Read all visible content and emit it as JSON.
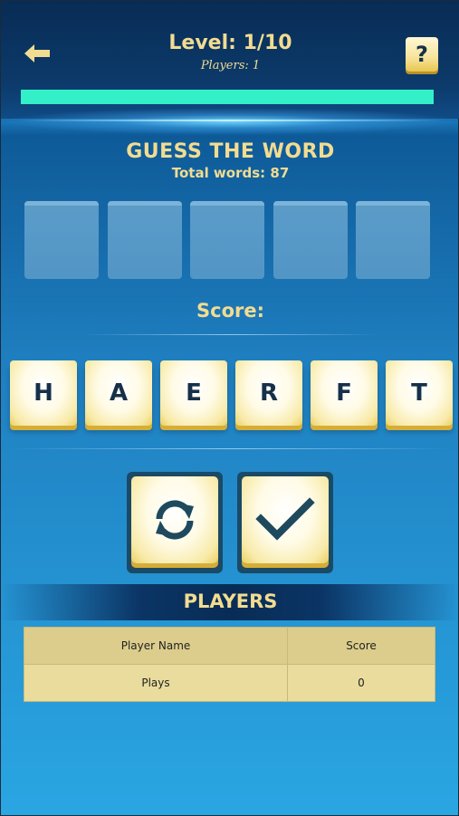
{
  "header": {
    "back_icon": "arrow-left-icon",
    "level_text": "Level: 1/10",
    "players_text": "Players: 1",
    "help_label": "?",
    "progress_fraction": 1.0
  },
  "game": {
    "title": "GUESS THE WORD",
    "total_words": "Total words: 87",
    "slot_count": 5,
    "score_label": "Score:",
    "letters": [
      "H",
      "A",
      "E",
      "R",
      "F",
      "T"
    ],
    "actions": [
      {
        "name": "shuffle-button",
        "icon": "refresh-icon"
      },
      {
        "name": "check-button",
        "icon": "checkmark-icon"
      }
    ]
  },
  "players": {
    "title": "PLAYERS",
    "columns": [
      "Player Name",
      "Score"
    ],
    "rows": [
      {
        "name": "Plays",
        "score": "0"
      }
    ]
  },
  "colors": {
    "accent_text": "#f2dc91",
    "progress": "#33f0c8",
    "tile_dark": "#16304a"
  }
}
